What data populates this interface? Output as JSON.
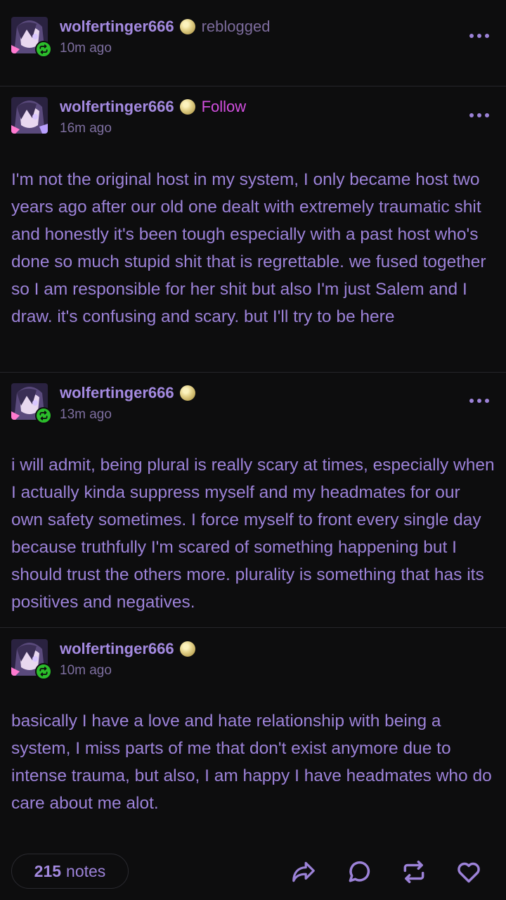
{
  "posts": [
    {
      "username": "wolfertinger666",
      "badge": "moon-badge",
      "action_label": "reblogged",
      "time": "10m ago",
      "reblogged": true
    },
    {
      "username": "wolfertinger666",
      "badge": "moon-badge",
      "action_label": "Follow",
      "time": "16m ago",
      "reblogged": false,
      "body": "I'm not the original host in my system, I only became host two years ago after our old one dealt with extremely traumatic shit and honestly it's been tough especially with a past host who's done so much stupid shit that is regrettable. we fused together so I am responsible for her shit but also I'm just Salem and I draw. it's confusing and scary. but I'll try to be here"
    },
    {
      "username": "wolfertinger666",
      "badge": "moon-badge",
      "time": "13m ago",
      "reblogged": true,
      "body": "i will admit, being plural is really scary at times, especially when I actually kinda suppress myself and my headmates for our own safety sometimes. I force myself to front every single day because truthfully I'm scared of something happening but I should trust the others more. plurality is something that has its positives and negatives."
    },
    {
      "username": "wolfertinger666",
      "badge": "moon-badge",
      "time": "10m ago",
      "reblogged": true,
      "body": "basically I have a love and hate relationship with being a system, I miss parts of me that don't exist anymore due to intense trauma, but also, I am happy I have headmates who do care about me alot."
    }
  ],
  "footer": {
    "notes_count": "215",
    "notes_label": "notes",
    "actions": [
      "share-icon",
      "reply-icon",
      "reblog-icon",
      "like-icon"
    ]
  },
  "colors": {
    "background": "#0d0d0e",
    "text": "#9c82d8",
    "follow": "#d24fe0",
    "reblog_badge": "#2bbd2b"
  }
}
